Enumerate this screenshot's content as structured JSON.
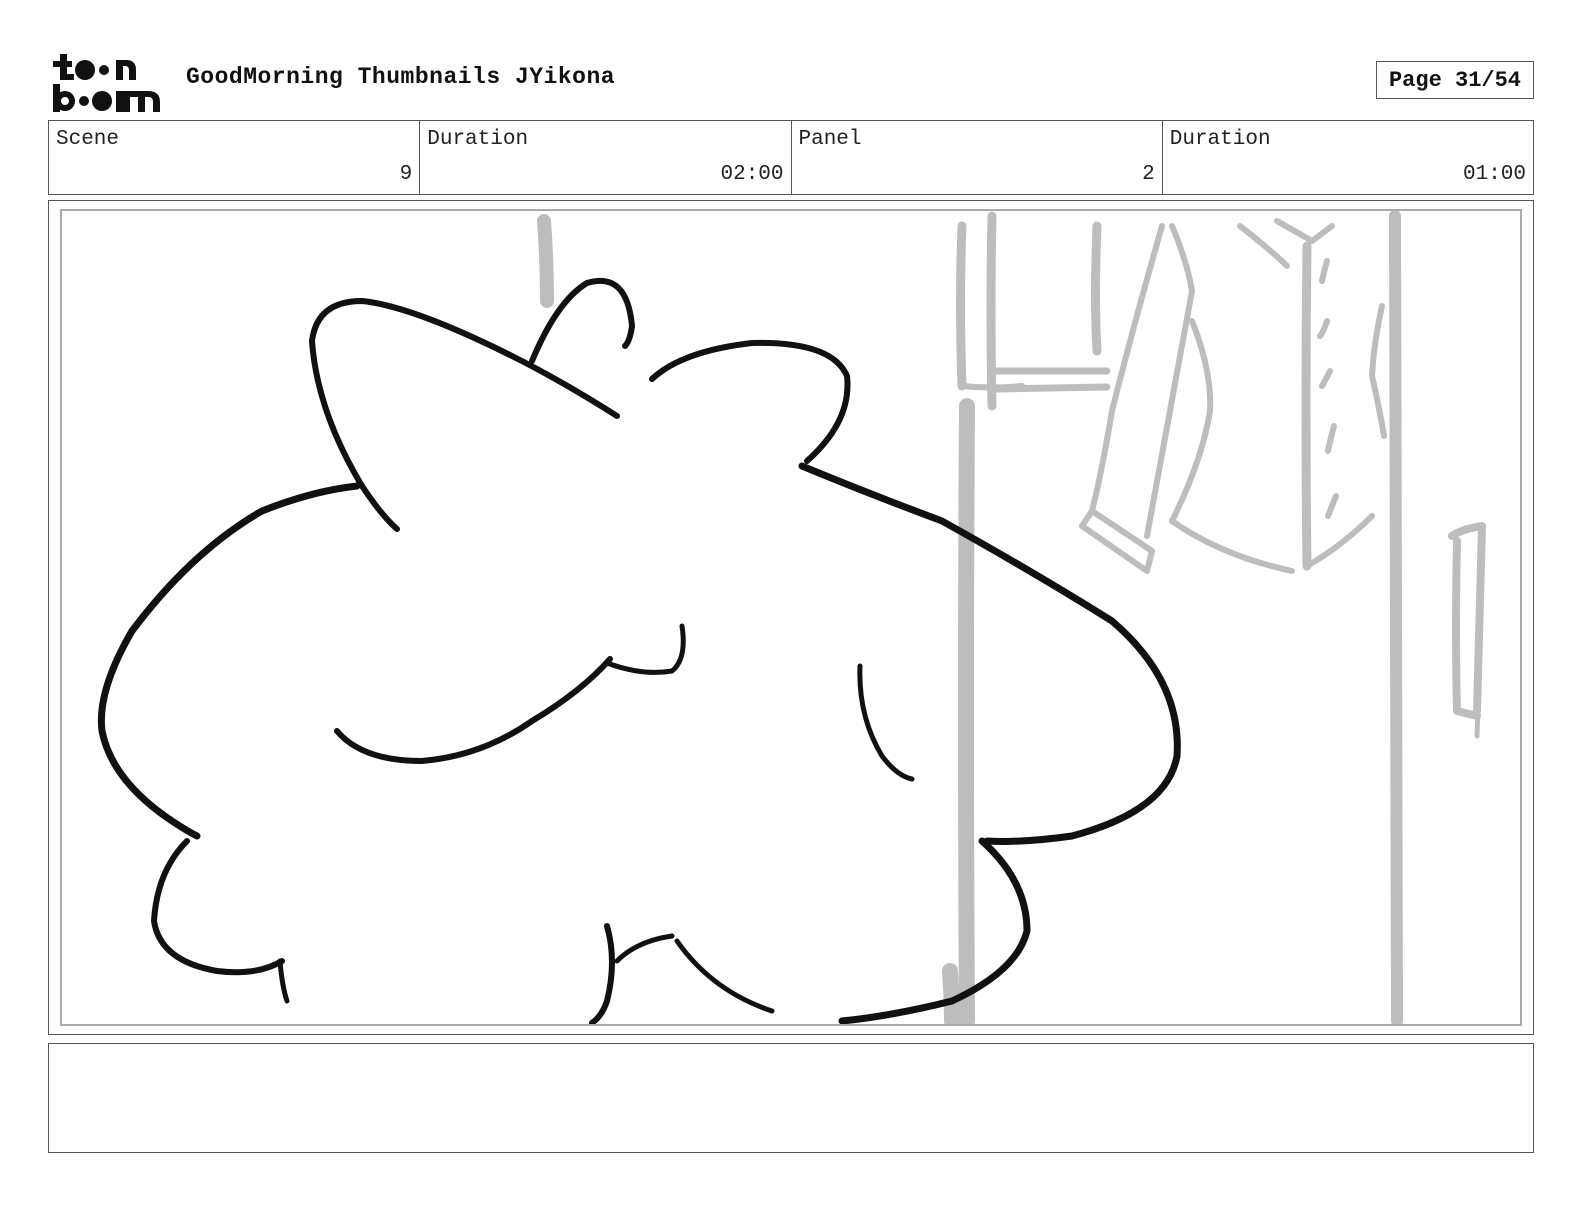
{
  "header": {
    "logo_text": "toon boom",
    "title": "GoodMorning Thumbnails JYikona",
    "page": "Page 31/54"
  },
  "info": {
    "scene_label": "Scene",
    "scene_value": "9",
    "scene_duration_label": "Duration",
    "scene_duration_value": "02:00",
    "panel_label": "Panel",
    "panel_value": "2",
    "panel_duration_label": "Duration",
    "panel_duration_value": "01:00"
  },
  "notes": {
    "text": ""
  },
  "colors": {
    "ink": "#111111",
    "background_sketch": "#bdbdbd",
    "border": "#555555"
  }
}
